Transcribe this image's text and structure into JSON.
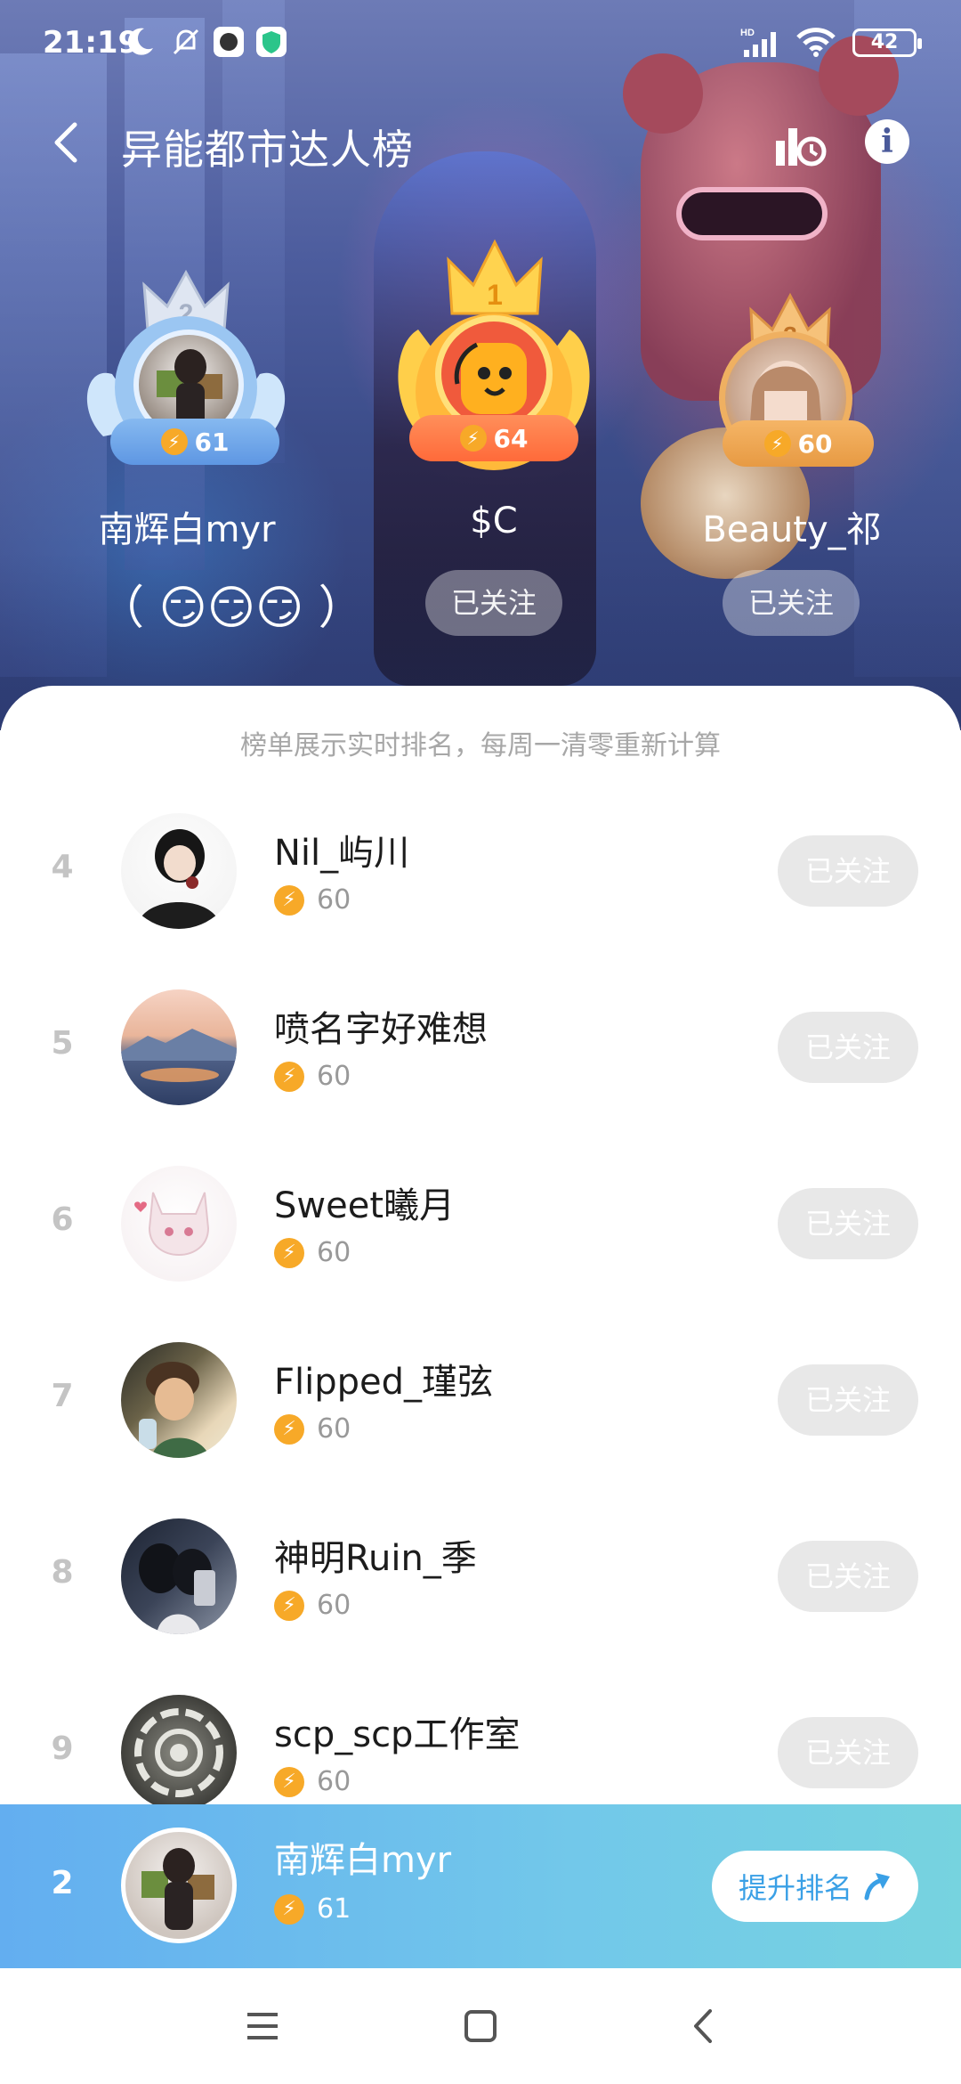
{
  "status_bar": {
    "time": "21:19",
    "battery": "42"
  },
  "header": {
    "title": "异能都市达人榜"
  },
  "podium": [
    {
      "rank": "2",
      "name": "南辉白myr",
      "score": "61",
      "extra": "（ 😏😏😏 ）"
    },
    {
      "rank": "1",
      "name": "$C",
      "score": "64",
      "follow": "已关注"
    },
    {
      "rank": "3",
      "name": "Beauty_祁",
      "score": "60",
      "follow": "已关注"
    }
  ],
  "notice": "榜单展示实时排名，每周一清零重新计算",
  "list": [
    {
      "rank": "4",
      "name": "Nil_屿川",
      "score": "60",
      "follow": "已关注"
    },
    {
      "rank": "5",
      "name": "喷名字好难想",
      "score": "60",
      "follow": "已关注"
    },
    {
      "rank": "6",
      "name": "Sweet曦月",
      "score": "60",
      "follow": "已关注"
    },
    {
      "rank": "7",
      "name": "Flipped_瑾弦",
      "score": "60",
      "follow": "已关注"
    },
    {
      "rank": "8",
      "name": "神明Ruin_季",
      "score": "60",
      "follow": "已关注"
    },
    {
      "rank": "9",
      "name": "scp_scp工作室",
      "score": "60",
      "follow": "已关注"
    }
  ],
  "self": {
    "rank": "2",
    "name": "南辉白myr",
    "score": "61",
    "promote_label": "提升排名"
  },
  "icons": {
    "bolt": "lightning-bolt-icon",
    "back": "chevron-left-icon",
    "chart": "ranking-chart-icon",
    "info": "info-icon"
  },
  "colors": {
    "accent_bolt": "#f7a928",
    "self_bar_start": "#63aef0",
    "self_bar_end": "#76d3df",
    "promote_text": "#3aa0e6"
  }
}
